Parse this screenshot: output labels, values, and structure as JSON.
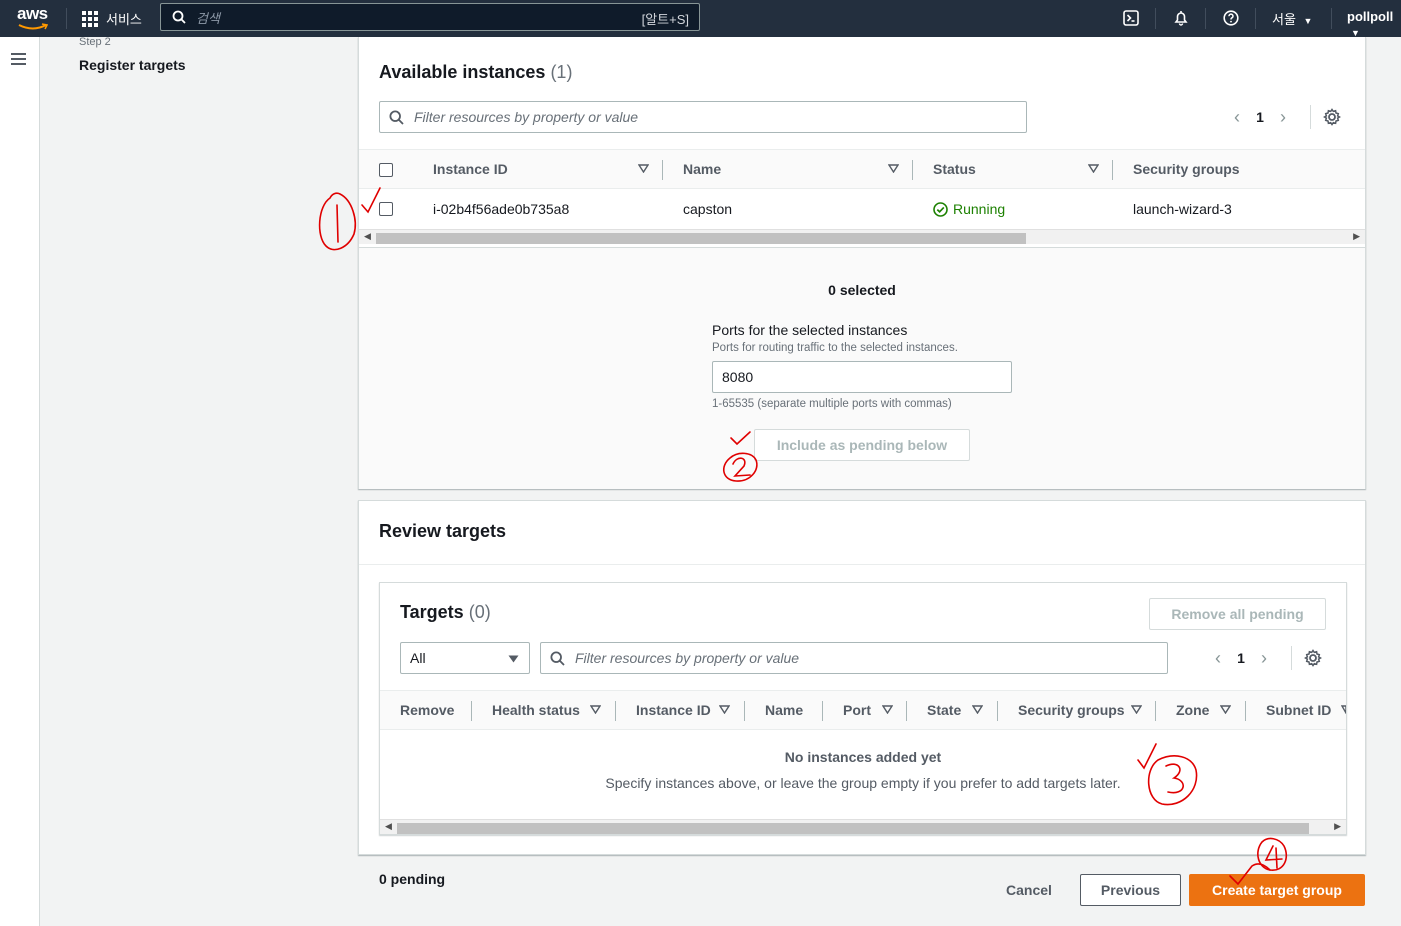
{
  "topnav": {
    "logo_text": "aws",
    "services_label": "서비스",
    "search_placeholder": "검색",
    "search_shortcut": "[알트+S]",
    "region": "서울",
    "account": "pollpoll"
  },
  "steps": {
    "step_label": "Step 2",
    "step_title": "Register targets"
  },
  "available": {
    "title": "Available instances",
    "count": "(1)",
    "filter_placeholder": "Filter resources by property or value",
    "page": "1",
    "columns": [
      "Instance ID",
      "Name",
      "Status",
      "Security groups"
    ],
    "rows": [
      {
        "instance_id": "i-02b4f56ade0b735a8",
        "name": "capston",
        "status": "Running",
        "security_group": "launch-wizard-3"
      }
    ],
    "selected_text": "0 selected",
    "ports_label": "Ports for the selected instances",
    "ports_desc": "Ports for routing traffic to the selected instances.",
    "ports_value": "8080",
    "ports_hint": "1-65535 (separate multiple ports with commas)",
    "include_button": "Include as pending below"
  },
  "review": {
    "title": "Review targets",
    "targets_title": "Targets",
    "targets_count": "(0)",
    "remove_all_button": "Remove all pending",
    "filter_select": "All",
    "filter_placeholder": "Filter resources by property or value",
    "page": "1",
    "columns": [
      "Remove",
      "Health status",
      "Instance ID",
      "Name",
      "Port",
      "State",
      "Security groups",
      "Zone",
      "Subnet ID"
    ],
    "empty_title": "No instances added yet",
    "empty_desc": "Specify instances above, or leave the group empty if you prefer to add targets later."
  },
  "footer": {
    "pending_text": "0 pending",
    "cancel": "Cancel",
    "previous": "Previous",
    "create": "Create target group"
  },
  "colors": {
    "nav_bg": "#232f3e",
    "primary": "#ec7211",
    "success": "#1d8102",
    "annotation": "#e00000"
  }
}
